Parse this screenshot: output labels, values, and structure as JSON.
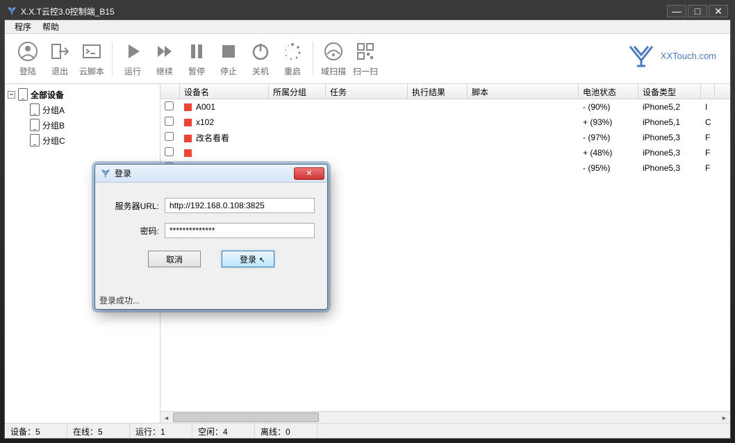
{
  "window": {
    "title": "X.X.T云控3.0控制端_B15"
  },
  "menu": {
    "program": "程序",
    "help": "帮助"
  },
  "toolbar": {
    "login": "登陆",
    "logout": "退出",
    "cloud_script": "云脚本",
    "run": "运行",
    "continue": "继续",
    "pause": "暂停",
    "stop": "停止",
    "shutdown": "关机",
    "restart": "重启",
    "scan": "域扫描",
    "qrscan": "扫一扫"
  },
  "brand": {
    "name": "XXTouch.com"
  },
  "tree": {
    "root": "全部设备",
    "groups": [
      "分组A",
      "分组B",
      "分组C"
    ]
  },
  "table": {
    "headers": {
      "name": "设备名",
      "group": "所属分组",
      "task": "任务",
      "result": "执行结果",
      "script": "脚本",
      "battery": "电池状态",
      "type": "设备类型"
    },
    "rows": [
      {
        "name": "A001",
        "sign": "-",
        "battery": "(90%)",
        "type": "iPhone5,2",
        "tail": "I"
      },
      {
        "name": "x102",
        "sign": "+",
        "battery": "(93%)",
        "type": "iPhone5,1",
        "tail": "C"
      },
      {
        "name": "改名看看",
        "sign": "-",
        "battery": "(97%)",
        "type": "iPhone5,3",
        "tail": "F"
      },
      {
        "name": "",
        "sign": "+",
        "battery": "(48%)",
        "type": "iPhone5,3",
        "tail": "F"
      },
      {
        "name": "",
        "sign": "-",
        "battery": "(95%)",
        "type": "iPhone5,3",
        "tail": "F"
      }
    ]
  },
  "dialog": {
    "title": "登录",
    "url_label": "服务器URL:",
    "url_value": "http://192.168.0.108:3825",
    "pwd_label": "密码:",
    "pwd_value": "**************",
    "cancel": "取消",
    "login": "登录",
    "status": "登录成功..."
  },
  "status": {
    "devices": "设备：5",
    "online": "在线：5",
    "running": "运行：1",
    "idle": "空闲：4",
    "offline": "离线：0"
  }
}
